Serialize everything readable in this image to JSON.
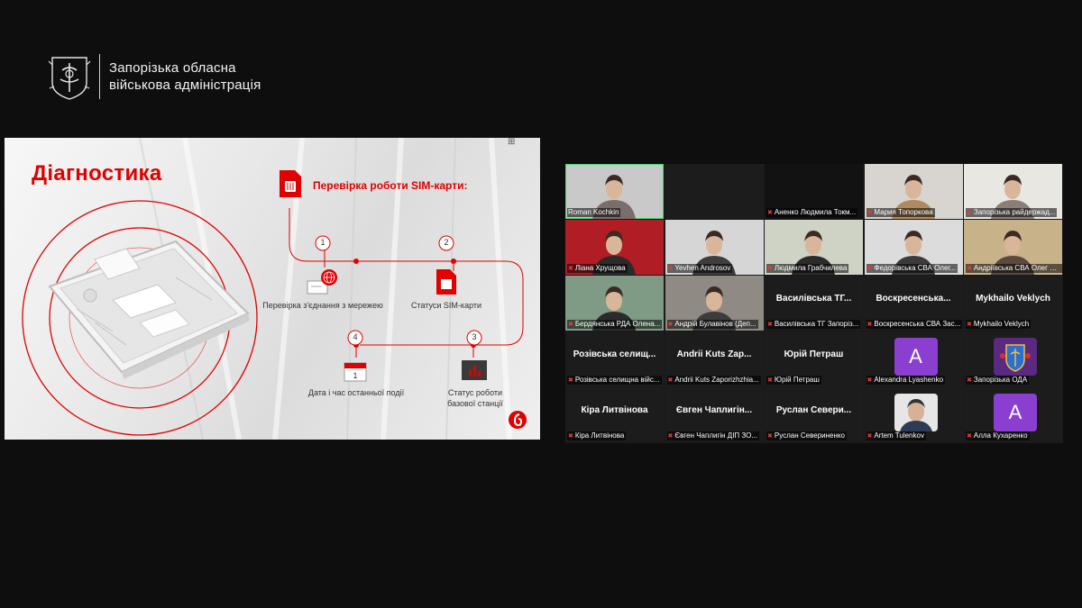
{
  "header": {
    "line1": "Запорізька обласна",
    "line2": "військова адміністрація"
  },
  "slide": {
    "title": "Діагностика",
    "sim_heading": "Перевірка роботи SIM-карти:",
    "steps": [
      {
        "num": "1",
        "label": "Перевірка з'єднання з мережею"
      },
      {
        "num": "2",
        "label": "Статуси SIM-карти"
      },
      {
        "num": "3",
        "label_l1": "Статус роботи",
        "label_l2": "базової станції"
      },
      {
        "num": "4",
        "label": "Дата і час останньої події"
      }
    ],
    "calendar_day": "1",
    "accent": "#e00000"
  },
  "participants": [
    {
      "name": "Roman Kochkin",
      "type": "video"
    },
    {
      "name": "",
      "type": "empty"
    },
    {
      "name": "Аненко Людмила Токм...",
      "type": "dark"
    },
    {
      "name": "Мария Топоркова",
      "type": "video"
    },
    {
      "name": "Запорізька райдержад...",
      "type": "video"
    },
    {
      "name": "Ліана Хрущова",
      "type": "video"
    },
    {
      "name": "Yevhen Androsov",
      "type": "video"
    },
    {
      "name": "Людмила Грабчилева",
      "type": "video"
    },
    {
      "name": "Федорівська СВА Олег...",
      "type": "video"
    },
    {
      "name": "Андріївська СВА Олег Д...",
      "type": "video"
    },
    {
      "name": "Бердянська РДА Олена...",
      "type": "video"
    },
    {
      "name": "Андрій Булавінов (Деп...",
      "type": "video"
    },
    {
      "big": "Василівська ТГ...",
      "name": "Василівська ТГ Запоріз...",
      "type": "text"
    },
    {
      "big": "Воскресенська...",
      "name": "Воскресенська СВА Зас...",
      "type": "text"
    },
    {
      "big": "Mykhailo Veklych",
      "name": "Mykhailo Veklych",
      "type": "text"
    },
    {
      "big": "Розівська селищ...",
      "name": "Розівська селищна війс...",
      "type": "text"
    },
    {
      "big": "Andrii Kuts Zap...",
      "name": "Andrii Kuts Zaporizhzhia...",
      "type": "text"
    },
    {
      "big": "Юрій Петраш",
      "name": "Юрій Петраш",
      "type": "text"
    },
    {
      "avatar": "A",
      "name": "Alexandra Lyashenko",
      "type": "avatar"
    },
    {
      "name": "Запорізька ОДА",
      "type": "emblem"
    },
    {
      "big": "Кіра Литвінова",
      "name": "Кіра Литвінова",
      "type": "text"
    },
    {
      "big": "Євген Чаплигін...",
      "name": "Євген Чаплигін ДІП ЗО...",
      "type": "text"
    },
    {
      "big": "Руслан Севери...",
      "name": "Руслан Севериненко",
      "type": "text"
    },
    {
      "name": "Artem Tulenkov",
      "type": "photo"
    },
    {
      "avatar": "A",
      "name": "Алла Кухаренко",
      "type": "avatar"
    }
  ],
  "colors": {
    "active_speaker": "#3ddc71",
    "muted_mic": "#e0403a",
    "avatar_bg": "#8b3fd0"
  }
}
